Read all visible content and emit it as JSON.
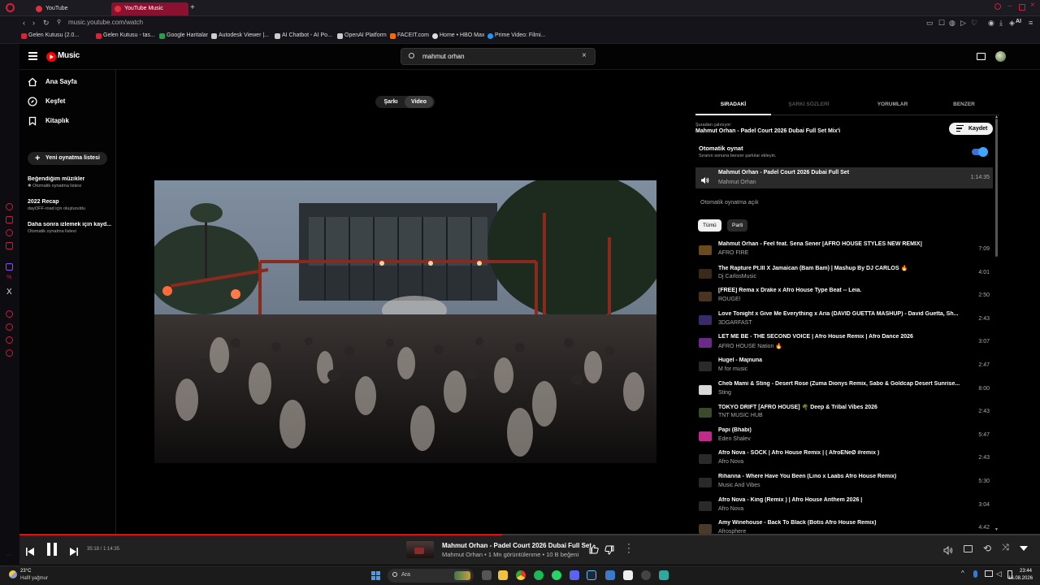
{
  "browser": {
    "tabs": [
      {
        "label": "YouTube"
      },
      {
        "label": "YouTube Music"
      }
    ],
    "url": "music.youtube.com/watch",
    "bookmarks": [
      {
        "label": "Gelen Kutusu (2.0..."
      },
      {
        "label": "Gelen Kutusu - tas..."
      },
      {
        "label": "Google Haritalar"
      },
      {
        "label": "Autodesk Viewer |..."
      },
      {
        "label": "AI Chatbot - AI Po..."
      },
      {
        "label": "OpenAI Platform"
      },
      {
        "label": "FACEIT.com"
      },
      {
        "label": "Home • HBO Max"
      },
      {
        "label": "Prime Video: Filmi..."
      }
    ],
    "ai_label": "AI"
  },
  "header": {
    "logo": "Music",
    "search_value": "mahmut orhan"
  },
  "nav": {
    "items": [
      {
        "label": "Ana Sayfa"
      },
      {
        "label": "Keşfet"
      },
      {
        "label": "Kitaplık"
      }
    ],
    "new_playlist": "Yeni oynatma listesi",
    "playlists": [
      {
        "title": "Beğendiğim müzikler",
        "sub": "Otomatik oynatma listesi"
      },
      {
        "title": "2022 Recap",
        "sub": "dayOFF-road için oluşturuldu"
      },
      {
        "title": "Daha sonra izlemek için kayd...",
        "sub": "Otomatik oynatma listesi"
      }
    ]
  },
  "main": {
    "toggle": {
      "song": "Şarkı",
      "video": "Video"
    }
  },
  "panel": {
    "tabs": [
      "SIRADAKİ",
      "ŞARKI SÖZLERİ",
      "YORUMLAR",
      "BENZER"
    ],
    "playing_from_label": "Şuradan çalınıyor:",
    "playing_from": "Mahmut Orhan - Padel Court 2026 Dubai Full Set Mix'i",
    "save": "Kaydet",
    "autoplay_title": "Otomatik oynat",
    "autoplay_sub": "Sıranın sonuna benzer şarkılar ekleyin.",
    "now_playing": {
      "title": "Mahmut Orhan - Padel Court 2026 Dubai Full Set",
      "artist": "Mahmut Orhan",
      "duration": "1:14:35"
    },
    "autoplay_on": "Otomatik oynatma açık",
    "chips": [
      "Tümü",
      "Parti"
    ],
    "queue": [
      {
        "title": "Mahmut Orhan - Feel feat. Sena Sener [AFRO HOUSE STYLES NEW REMIX]",
        "artist": "AFRO FIRE",
        "duration": "7:09",
        "color": "#6b4a1e"
      },
      {
        "title": "The Rapture Pt.III X Jamaican (Bam Bam) | Mashup By DJ CARLOS 🔥",
        "artist": "Dj CarlosMusic",
        "duration": "4:01",
        "color": "#3a2a1a"
      },
      {
        "title": "[FREE] Rema x Drake x Afro House Type Beat -- Leia.",
        "artist": "ROUGE!",
        "duration": "2:50",
        "color": "#4a3320"
      },
      {
        "title": "Love Tonight x Give Me Everything x Aria (DAVID GUETTA MASHUP) - David Guetta, Sh...",
        "artist": "3DGARFAST",
        "duration": "2:43",
        "color": "#3b2a6a"
      },
      {
        "title": "LET ME BE - THE SECOND VOICE | Afro House Remix | Afro Dance 2026",
        "artist": "AFRO HOUSE Nation 🔥",
        "duration": "3:07",
        "color": "#6a2a8a"
      },
      {
        "title": "Hugel - Majnuna",
        "artist": "M for music",
        "duration": "2:47",
        "color": "#2a2a2a"
      },
      {
        "title": "Cheb Mami & Sting - Desert Rose (Zuma Dionys Remix, Sabo & Goldcap Desert Sunrise...",
        "artist": "Sting",
        "duration": "8:00",
        "color": "#d8d8d8"
      },
      {
        "title": "TOKYO DRIFT [AFRO HOUSE] 🌴 Deep & Tribal Vibes 2026",
        "artist": "TNT MUSIC HUB",
        "duration": "2:43",
        "color": "#3a4a2a"
      },
      {
        "title": "Papi (Bhabi)",
        "artist": "Eden Shalev",
        "duration": "5:47",
        "color": "#c02a8a"
      },
      {
        "title": "Afro Nova - SOCK | Afro House Remix | ( AfroENeØ #remix )",
        "artist": "Afro Nova",
        "duration": "2:43",
        "color": "#2a2a2a"
      },
      {
        "title": "Rihanna - Where Have You Been (Lino x Laabs Afro House Remix)",
        "artist": "Music And Vibes",
        "duration": "5:30",
        "color": "#2a2a2a"
      },
      {
        "title": "Afro Nova - King (Remix ) | Afro House Anthem 2026 |",
        "artist": "Afro Nova",
        "duration": "3:04",
        "color": "#2a2a2a"
      },
      {
        "title": "Amy Winehouse - Back To Black (Botis Afro House Remix)",
        "artist": "Afrosphere",
        "duration": "4:42",
        "color": "#4a3a2a"
      }
    ]
  },
  "player": {
    "time": "35:18 / 1:14:35",
    "progress": 0.473,
    "title": "Mahmut Orhan - Padel Court 2026 Dubai Full Set",
    "subtitle": "Mahmut Orhan • 1 Mn görüntülenme • 10 B beğeni"
  },
  "taskbar": {
    "weather_temp": "23°C",
    "weather_desc": "Hafif yağmur",
    "search": "Ara",
    "time": "23:44",
    "date": "16.08.2026"
  }
}
